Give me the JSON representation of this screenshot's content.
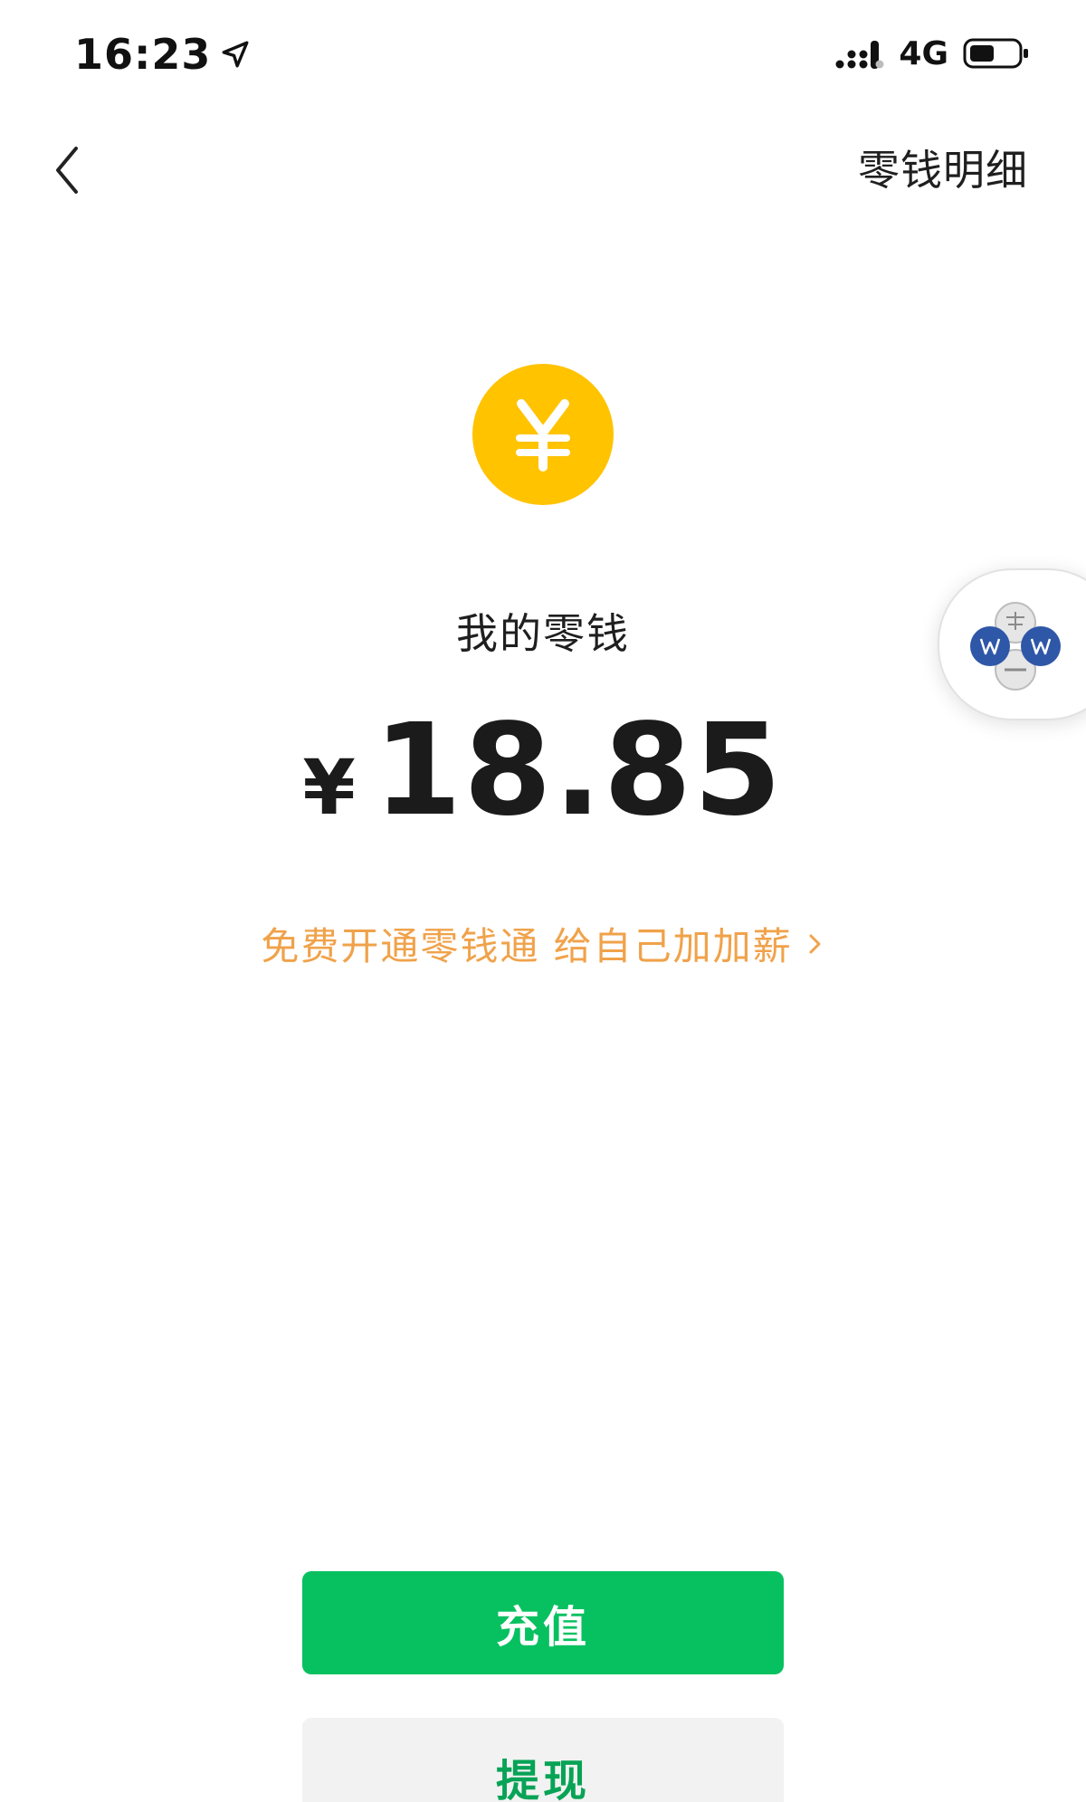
{
  "status_bar": {
    "time": "16:23",
    "network": "4G",
    "icons": [
      "location-arrow-icon",
      "signal-icon",
      "battery-icon"
    ]
  },
  "nav": {
    "back_icon": "chevron-left-icon",
    "details_label": "零钱明细"
  },
  "balance": {
    "coin_icon": "yuan-coin-icon",
    "title": "我的零钱",
    "currency": "¥",
    "amount": "18.85"
  },
  "promo": {
    "text": "免费开通零钱通 给自己加加薪",
    "chevron_icon": "chevron-right-icon"
  },
  "floating_widget": {
    "icon": "floating-widget-logo-icon"
  },
  "actions": {
    "topup_label": "充值",
    "withdraw_label": "提现"
  },
  "colors": {
    "primary_green": "#07c160",
    "coin_yellow": "#ffc300",
    "promo_orange": "#f0a24a",
    "secondary_button_bg": "#f2f2f2"
  }
}
